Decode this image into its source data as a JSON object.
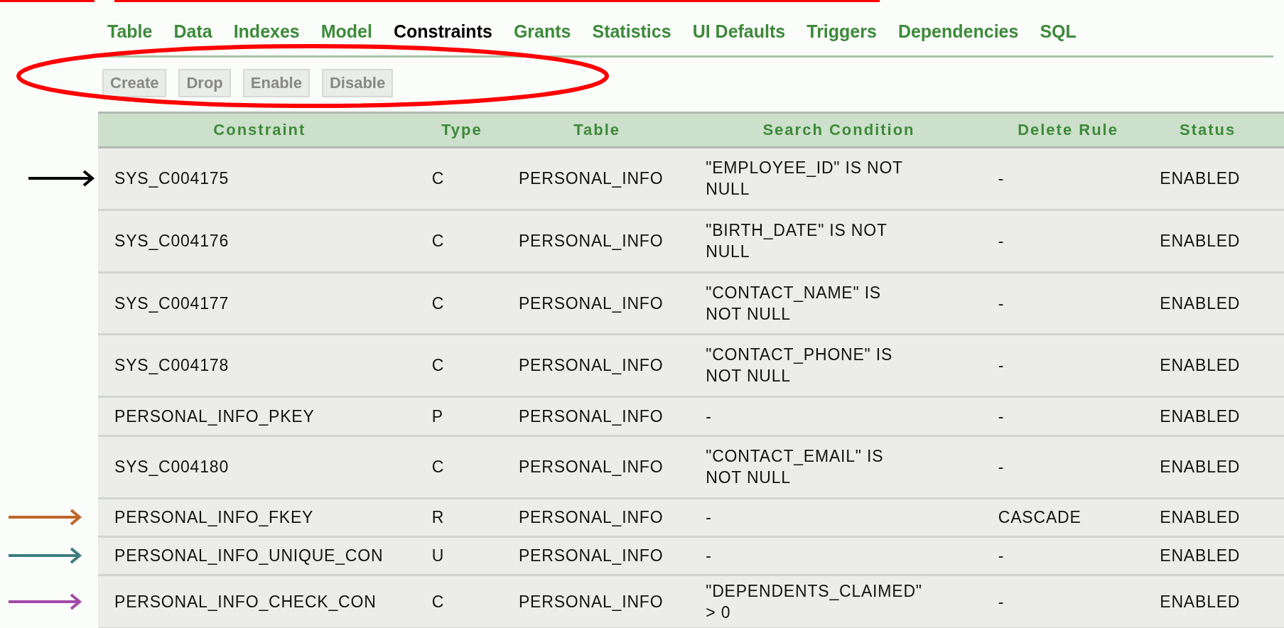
{
  "tabs": [
    {
      "label": "Table",
      "selected": false
    },
    {
      "label": "Data",
      "selected": false
    },
    {
      "label": "Indexes",
      "selected": false
    },
    {
      "label": "Model",
      "selected": false
    },
    {
      "label": "Constraints",
      "selected": true
    },
    {
      "label": "Grants",
      "selected": false
    },
    {
      "label": "Statistics",
      "selected": false
    },
    {
      "label": "UI Defaults",
      "selected": false
    },
    {
      "label": "Triggers",
      "selected": false
    },
    {
      "label": "Dependencies",
      "selected": false
    },
    {
      "label": "SQL",
      "selected": false
    }
  ],
  "toolbar": {
    "buttons": [
      {
        "label": "Create",
        "disabled": true
      },
      {
        "label": "Drop",
        "disabled": true
      },
      {
        "label": "Enable",
        "disabled": true
      },
      {
        "label": "Disable",
        "disabled": true
      }
    ]
  },
  "table": {
    "columns": [
      "Constraint",
      "Type",
      "Table",
      "Search Condition",
      "Delete Rule",
      "Status"
    ],
    "rows": [
      {
        "cells": [
          "SYS_C004175",
          "C",
          "PERSONAL_INFO",
          "\"EMPLOYEE_ID\" IS NOT NULL",
          "-",
          "ENABLED"
        ],
        "color": "#000000"
      },
      {
        "cells": [
          "SYS_C004176",
          "C",
          "PERSONAL_INFO",
          "\"BIRTH_DATE\" IS NOT NULL",
          "-",
          "ENABLED"
        ]
      },
      {
        "cells": [
          "SYS_C004177",
          "C",
          "PERSONAL_INFO",
          "\"CONTACT_NAME\" IS NOT NULL",
          "-",
          "ENABLED"
        ]
      },
      {
        "cells": [
          "SYS_C004178",
          "C",
          "PERSONAL_INFO",
          "\"CONTACT_PHONE\" IS NOT NULL",
          "-",
          "ENABLED"
        ]
      },
      {
        "cells": [
          "PERSONAL_INFO_PKEY",
          "P",
          "PERSONAL_INFO",
          "-",
          "-",
          "ENABLED"
        ]
      },
      {
        "cells": [
          "SYS_C004180",
          "C",
          "PERSONAL_INFO",
          "\"CONTACT_EMAIL\" IS NOT NULL",
          "-",
          "ENABLED"
        ]
      },
      {
        "cells": [
          "PERSONAL_INFO_FKEY",
          "R",
          "PERSONAL_INFO",
          "-",
          "CASCADE",
          "ENABLED"
        ],
        "color": "#c0652c"
      },
      {
        "cells": [
          "PERSONAL_INFO_UNIQUE_CON",
          "U",
          "PERSONAL_INFO",
          "-",
          "-",
          "ENABLED"
        ],
        "color": "#3f7d80"
      },
      {
        "cells": [
          "PERSONAL_INFO_CHECK_CON",
          "C",
          "PERSONAL_INFO",
          "\"DEPENDENTS_CLAIMED\" > 0",
          "-",
          "ENABLED"
        ],
        "color": "#a34aa8"
      }
    ]
  }
}
